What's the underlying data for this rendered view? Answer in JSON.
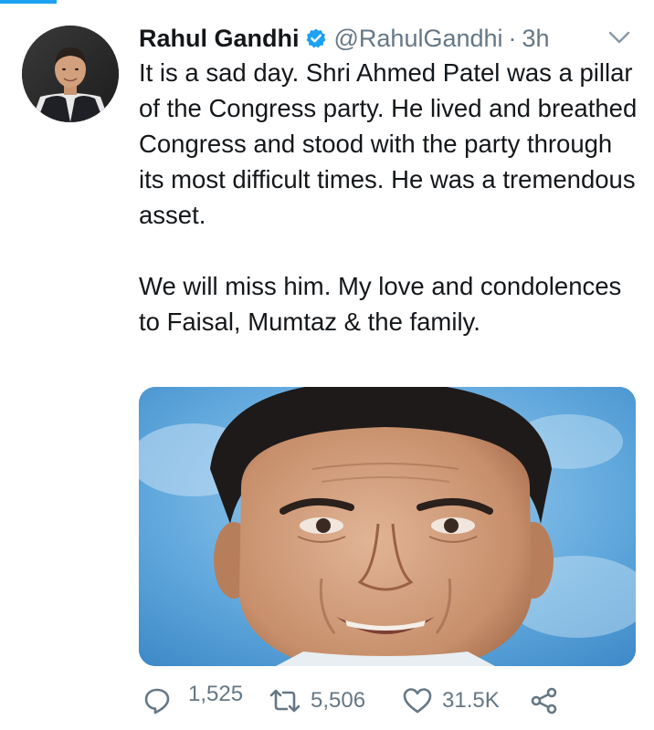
{
  "tweet": {
    "display_name": "Rahul Gandhi",
    "handle": "@RahulGandhi",
    "separator": "·",
    "time": "3h",
    "paragraph_1": "It is a sad day. Shri Ahmed Patel was a pillar of the Congress party. He lived and breathed Congress and stood with the party through its most difficult times. He was a tremendous asset.",
    "paragraph_2": "We will miss him. My love and condolences to Faisal, Mumtaz & the family."
  },
  "icons": {
    "verified": "verified-badge-icon",
    "caret": "chevron-down-icon",
    "reply": "reply-icon",
    "retweet": "retweet-icon",
    "like": "heart-icon",
    "share": "share-icon"
  },
  "actions": {
    "replies": "1,525",
    "retweets": "5,506",
    "likes": "31.5K"
  },
  "colors": {
    "accent": "#1da1f2",
    "secondary_text": "#657786",
    "primary_text": "#14171a"
  }
}
